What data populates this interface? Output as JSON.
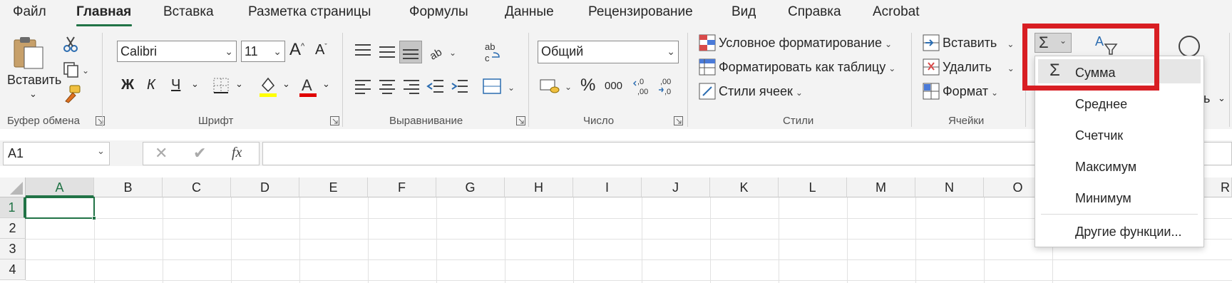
{
  "tabs": [
    "Файл",
    "Главная",
    "Вставка",
    "Разметка страницы",
    "Формулы",
    "Данные",
    "Рецензирование",
    "Вид",
    "Справка",
    "Acrobat"
  ],
  "clipboard": {
    "paste_label": "Вставить",
    "group_label": "Буфер обмена"
  },
  "font": {
    "name": "Calibri",
    "size": "11",
    "bold": "Ж",
    "italic": "К",
    "underline": "Ч",
    "group_label": "Шрифт"
  },
  "alignment": {
    "group_label": "Выравнивание"
  },
  "number": {
    "format": "Общий",
    "percent": "%",
    "thousands": "000",
    "group_label": "Число"
  },
  "styles": {
    "conditional": "Условное форматирование",
    "as_table": "Форматировать как таблицу",
    "cell_styles": "Стили ячеек",
    "group_label": "Стили"
  },
  "cells": {
    "insert": "Вставить",
    "delete": "Удалить",
    "format": "Формат",
    "group_label": "Ячейки"
  },
  "formula_bar": {
    "name_box": "A1",
    "fx": "fx",
    "formula": ""
  },
  "columns": [
    "A",
    "B",
    "C",
    "D",
    "E",
    "F",
    "G",
    "H",
    "I",
    "J",
    "K",
    "L",
    "M",
    "N",
    "O",
    "R"
  ],
  "rows": [
    "1",
    "2",
    "3",
    "4"
  ],
  "autosum_menu": {
    "items": [
      "Сумма",
      "Среднее",
      "Счетчик",
      "Максимум",
      "Минимум",
      "Другие функции..."
    ]
  },
  "colors": {
    "accent": "#217346",
    "highlight": "#d81e23",
    "font_highlight": "#ffff00",
    "font_color": "#e00000"
  }
}
